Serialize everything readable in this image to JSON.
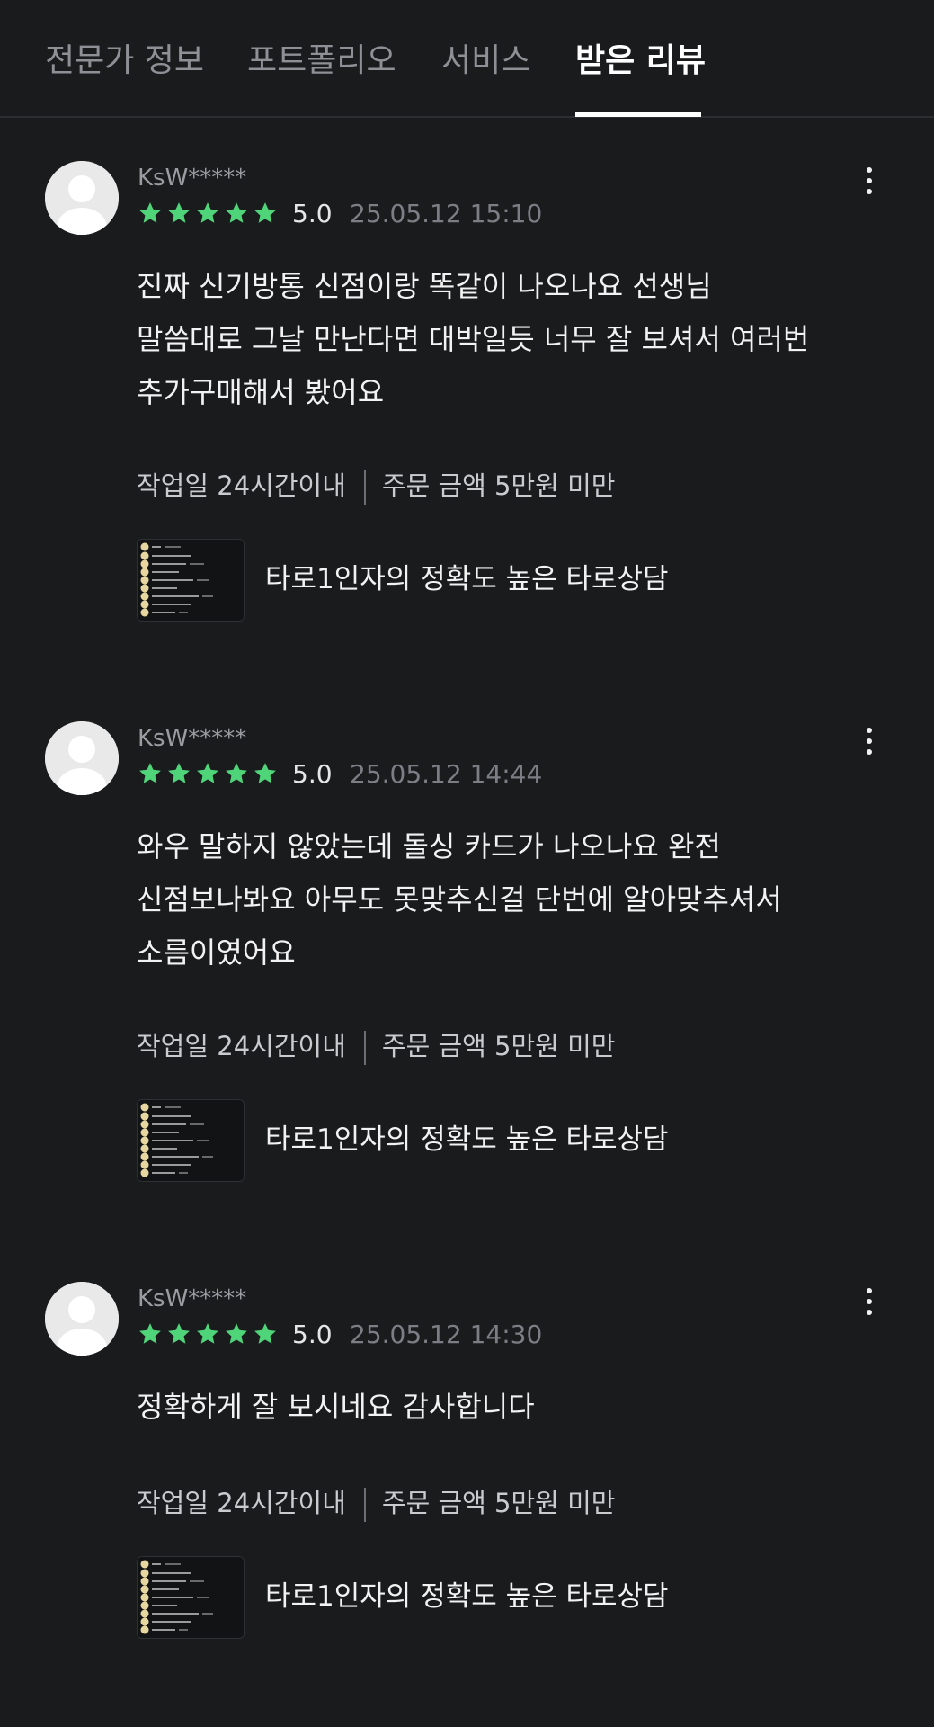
{
  "tabs": [
    {
      "label": "전문가 정보",
      "active": false
    },
    {
      "label": "포트폴리오",
      "active": false
    },
    {
      "label": "서비스",
      "active": false
    },
    {
      "label": "받은 리뷰",
      "active": true
    }
  ],
  "colors": {
    "background": "#1a1b1d",
    "star": "#4fd47a",
    "text_muted": "#7b7e84"
  },
  "icons": {
    "more": "more-vertical-icon",
    "star": "star-icon",
    "avatar": "user-avatar-icon"
  },
  "reviews": [
    {
      "reviewer": "KsW*****",
      "stars": 5,
      "rating": "5.0",
      "date": "25.05.12 15:10",
      "body_lines": [
        "진짜 신기방통 신점이랑 똑같이 나오나요 선생님",
        "말씀대로 그날 만난다면 대박일듯 너무 잘 보셔서 여러번",
        "추가구매해서 봤어요"
      ],
      "work_days": "작업일 24시간이내",
      "order_amount": "주문 금액 5만원 미만",
      "service_title": "타로1인자의 정확도 높은 타로상담"
    },
    {
      "reviewer": "KsW*****",
      "stars": 5,
      "rating": "5.0",
      "date": "25.05.12 14:44",
      "body_lines": [
        "와우 말하지 않았는데 돌싱 카드가 나오나요 완전",
        "신점보나봐요 아무도 못맞추신걸 단번에 알아맞추셔서",
        "소름이였어요"
      ],
      "work_days": "작업일 24시간이내",
      "order_amount": "주문 금액 5만원 미만",
      "service_title": "타로1인자의 정확도 높은 타로상담"
    },
    {
      "reviewer": "KsW*****",
      "stars": 5,
      "rating": "5.0",
      "date": "25.05.12 14:30",
      "body_lines": [
        "정확하게 잘 보시네요 감사합니다"
      ],
      "work_days": "작업일 24시간이내",
      "order_amount": "주문 금액 5만원 미만",
      "service_title": "타로1인자의 정확도 높은 타로상담"
    }
  ]
}
